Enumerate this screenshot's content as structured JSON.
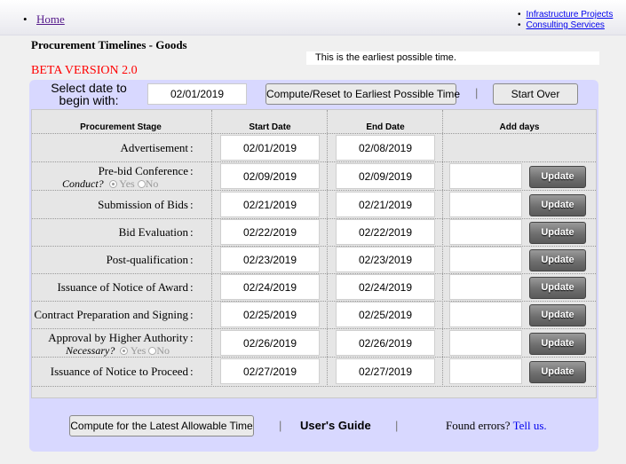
{
  "nav": {
    "home": "Home",
    "links": [
      "Infrastructure Projects",
      "Consulting Services"
    ]
  },
  "header": {
    "title": "Procurement Timelines - Goods",
    "status": "This is the earliest possible time.",
    "beta": "BETA VERSION 2.0"
  },
  "controls": {
    "select_label": "Select date to begin with:",
    "begin_date": "02/01/2019",
    "compute_reset": "Compute/Reset to Earliest Possible Time",
    "start_over": "Start Over",
    "separator": "|"
  },
  "table": {
    "headers": [
      "Procurement Stage",
      "Start Date",
      "End Date",
      "Add days"
    ],
    "update_label": "Update",
    "colon": ":",
    "rows": [
      {
        "stage": "Advertisement",
        "start": "02/01/2019",
        "end": "02/08/2019"
      },
      {
        "stage": "Pre-bid Conference",
        "sub": "Conduct?",
        "start": "02/09/2019",
        "end": "02/09/2019"
      },
      {
        "stage": "Submission of Bids",
        "start": "02/21/2019",
        "end": "02/21/2019"
      },
      {
        "stage": "Bid Evaluation",
        "start": "02/22/2019",
        "end": "02/22/2019"
      },
      {
        "stage": "Post-qualification",
        "start": "02/23/2019",
        "end": "02/23/2019"
      },
      {
        "stage": "Issuance of Notice of Award",
        "start": "02/24/2019",
        "end": "02/24/2019"
      },
      {
        "stage": "Contract Preparation and Signing",
        "start": "02/25/2019",
        "end": "02/25/2019"
      },
      {
        "stage": "Approval by Higher Authority",
        "sub": "Necessary?",
        "start": "02/26/2019",
        "end": "02/26/2019"
      },
      {
        "stage": "Issuance of Notice to Proceed",
        "start": "02/27/2019",
        "end": "02/27/2019"
      }
    ],
    "radio_yes": "Yes",
    "radio_no": "No"
  },
  "footer": {
    "compute_latest": "Compute for the Latest Allowable Time",
    "guide": "User's Guide",
    "errors_text": "Found errors?",
    "tell_us": "Tell us."
  }
}
